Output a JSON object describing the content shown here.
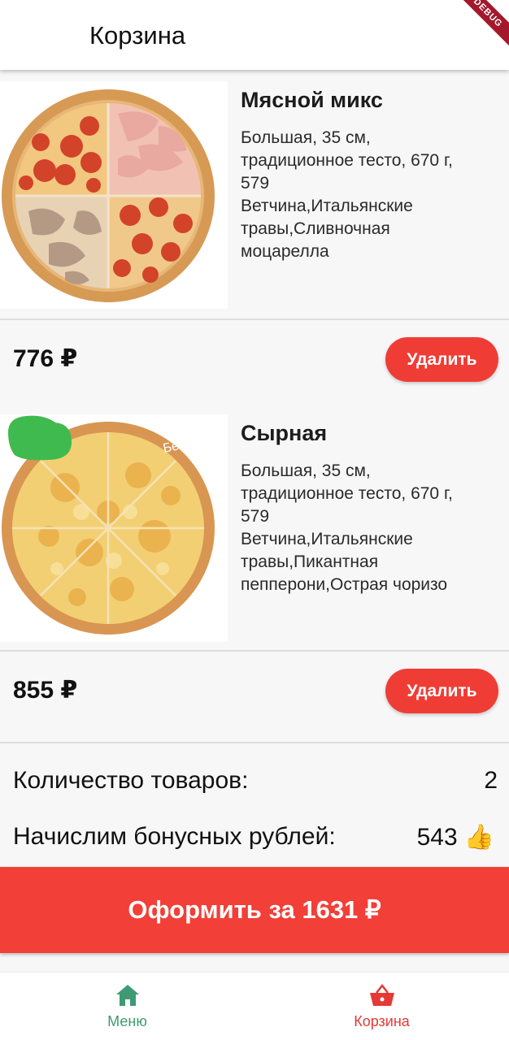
{
  "appbar": {
    "title": "Корзина",
    "debug_banner": "DEBUG"
  },
  "items": [
    {
      "name": "Мясной микс",
      "description": "Большая, 35 см,\nтрадиционное тесто, 670 г,\n579\nВетчина,Итальянские\nтравы,Сливночная\nмоцарелла",
      "price": "776 ₽",
      "delete_label": "Удалить",
      "image_icon": "meat-mix-pizza-image"
    },
    {
      "name": "Сырная",
      "description": "Большая, 35 см,\nтрадиционное тесто, 670 г,\n579\nВетчина,Итальянские\nтравы,Пикантная\nпепперони,Острая чоризо",
      "price": "855 ₽",
      "delete_label": "Удалить",
      "badge": "Без мяса",
      "image_icon": "cheese-pizza-image"
    }
  ],
  "summary": {
    "count_label": "Количество товаров:",
    "count_value": "2",
    "bonus_label": "Начислим бонусных рублей:",
    "bonus_value": "543",
    "bonus_icon": "thumbs-up-icon"
  },
  "checkout": {
    "label": "Оформить за 1631 ₽"
  },
  "bottom_nav": {
    "items": [
      {
        "label": "Меню",
        "icon": "home-icon",
        "color": "#3f9a73"
      },
      {
        "label": "Корзина",
        "icon": "basket-icon",
        "color": "#e53935",
        "active": true
      }
    ]
  },
  "colors": {
    "accent": "#f23f37",
    "delete_button": "#ef3d36",
    "menu_green": "#3f9a73"
  }
}
